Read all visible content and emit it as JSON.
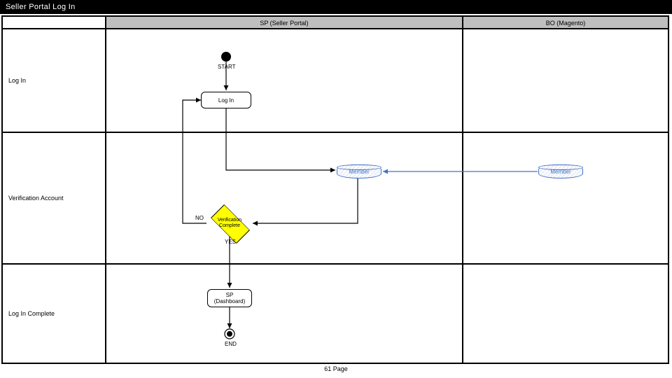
{
  "title": "Seller Portal Log In",
  "columns": {
    "row_label_w": 148,
    "sp_w": 510,
    "bo_w": 294
  },
  "lanes": {
    "blank": "",
    "sp": "SP (Seller Portal)",
    "bo": "BO (Magento)"
  },
  "rows": {
    "login": {
      "label": "Log In",
      "h": 148
    },
    "verify": {
      "label": "Verification Account",
      "h": 188
    },
    "complete": {
      "label": "Log In Complete",
      "h": 142
    }
  },
  "nodes": {
    "start": "START",
    "login_box": "Log In",
    "member_sp": "Member",
    "member_bo": "Member",
    "decision": "Verification\nComplete",
    "decision_no": "NO",
    "decision_yes": "YES",
    "dashboard": "SP\n(Dashboard)",
    "end": "END"
  },
  "footer": "61 Page"
}
